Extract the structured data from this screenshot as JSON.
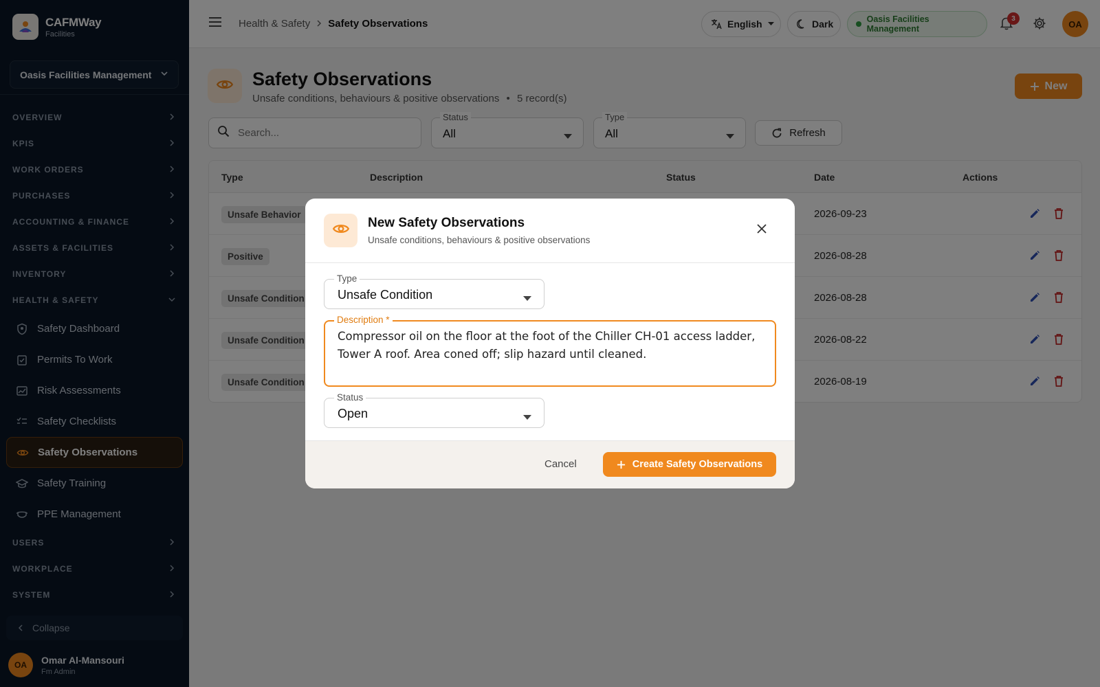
{
  "brand": {
    "name_part1": "CAFM",
    "name_part2": "Way",
    "subtitle": "Facilities"
  },
  "org_selector": {
    "value": "Oasis Facilities Management"
  },
  "sidebar": {
    "sections": [
      {
        "label": "OVERVIEW"
      },
      {
        "label": "KPIS"
      },
      {
        "label": "WORK ORDERS"
      },
      {
        "label": "PURCHASES"
      },
      {
        "label": "ACCOUNTING & FINANCE"
      },
      {
        "label": "ASSETS & FACILITIES"
      },
      {
        "label": "INVENTORY"
      },
      {
        "label": "HEALTH & SAFETY"
      }
    ],
    "health_items": [
      {
        "label": "Safety Dashboard",
        "icon": "shield-icon"
      },
      {
        "label": "Permits To Work",
        "icon": "clipboard-check-icon"
      },
      {
        "label": "Risk Assessments",
        "icon": "image-chart-icon"
      },
      {
        "label": "Safety Checklists",
        "icon": "checklist-icon"
      },
      {
        "label": "Safety Observations",
        "icon": "eye-icon",
        "active": true
      },
      {
        "label": "Safety Training",
        "icon": "graduation-cap-icon"
      },
      {
        "label": "PPE Management",
        "icon": "mask-icon"
      }
    ],
    "bottom_sections": [
      {
        "label": "USERS"
      },
      {
        "label": "WORKPLACE"
      },
      {
        "label": "SYSTEM"
      }
    ],
    "collapse_label": "Collapse"
  },
  "user": {
    "initials": "OA",
    "name": "Omar Al-Mansouri",
    "role": "Fm Admin"
  },
  "topbar": {
    "breadcrumb_parent": "Health & Safety",
    "breadcrumb_current": "Safety Observations",
    "language": "English",
    "theme": "Dark",
    "org_badge": "Oasis Facilities Management",
    "notification_count": "3",
    "avatar_initials": "OA"
  },
  "page": {
    "title": "Safety Observations",
    "subtitle": "Unsafe conditions, behaviours & positive observations",
    "separator": "•",
    "record_count": "5 record(s)",
    "new_button": "New"
  },
  "filters": {
    "search_placeholder": "Search...",
    "status_label": "Status",
    "status_value": "All",
    "type_label": "Type",
    "type_value": "All",
    "refresh_label": "Refresh"
  },
  "table": {
    "headers": {
      "type": "Type",
      "description": "Description",
      "status": "Status",
      "date": "Date",
      "actions": "Actions"
    },
    "rows": [
      {
        "type": "Unsafe Behavior",
        "date": "2026-09-23"
      },
      {
        "type": "Positive",
        "date": "2026-08-28"
      },
      {
        "type": "Unsafe Condition",
        "date": "2026-08-28"
      },
      {
        "type": "Unsafe Condition",
        "date": "2026-08-22"
      },
      {
        "type": "Unsafe Condition",
        "date": "2026-08-19"
      }
    ]
  },
  "modal": {
    "title": "New Safety Observations",
    "subtitle": "Unsafe conditions, behaviours & positive observations",
    "type_label": "Type",
    "type_value": "Unsafe Condition",
    "description_label": "Description *",
    "description_value": "Compressor oil on the floor at the foot of the Chiller CH-01 access ladder, Tower A roof. Area coned off; slip hazard until cleaned.",
    "status_label": "Status",
    "status_value": "Open",
    "cancel_label": "Cancel",
    "create_label": "Create Safety Observations"
  },
  "colors": {
    "accent": "#f0891e",
    "sidebar_bg": "#0b1726",
    "org_badge_green": "#2e7d32",
    "edit_blue": "#2f4fb5",
    "delete_red": "#c62828"
  }
}
